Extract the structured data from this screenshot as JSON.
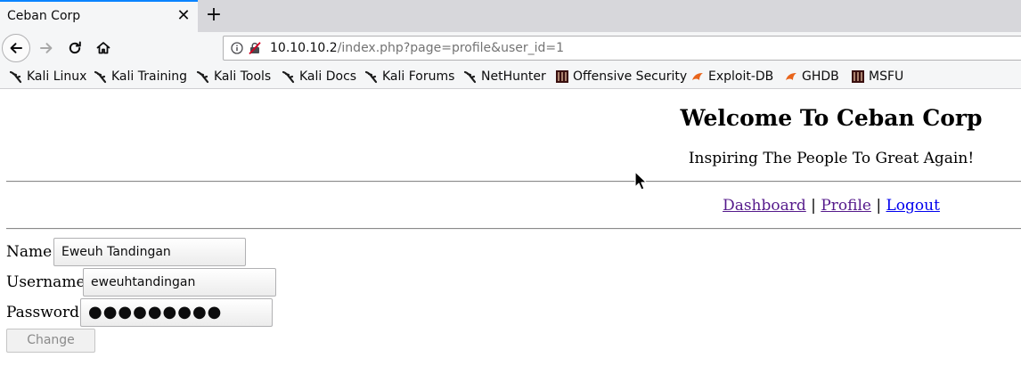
{
  "browser": {
    "tab_title": "Ceban Corp",
    "close_symbol": "✕",
    "new_tab_symbol": "+",
    "url_host": "10.10.10.2",
    "url_path": "/index.php?page=profile&user_id=1",
    "bookmarks": [
      {
        "label": "Kali Linux",
        "icon": "kali-dragon-icon"
      },
      {
        "label": "Kali Training",
        "icon": "kali-dragon-icon"
      },
      {
        "label": "Kali Tools",
        "icon": "kali-dragon-icon"
      },
      {
        "label": "Kali Docs",
        "icon": "kali-dragon-icon"
      },
      {
        "label": "Kali Forums",
        "icon": "kali-dragon-icon"
      },
      {
        "label": "NetHunter",
        "icon": "kali-dragon-icon"
      },
      {
        "label": "Offensive Security",
        "icon": "offsec-icon"
      },
      {
        "label": "Exploit-DB",
        "icon": "exploit-db-icon"
      },
      {
        "label": "GHDB",
        "icon": "exploit-db-icon"
      },
      {
        "label": "MSFU",
        "icon": "offsec-icon"
      }
    ]
  },
  "page": {
    "heading": "Welcome To Ceban Corp",
    "tagline": "Inspiring The People To Great Again!",
    "nav": {
      "dashboard": "Dashboard",
      "separator": "|",
      "profile": "Profile",
      "logout": "Logout"
    },
    "form": {
      "name_label": "Name",
      "name_value": "Eweuh Tandingan",
      "username_label": "Username",
      "username_value": "eweuhtandingan",
      "password_label": "Password",
      "password_masked": "●●●●●●●●●",
      "change_label": "Change"
    }
  },
  "colors": {
    "tab_accent": "#0a84ff",
    "visited_link": "#551a8b",
    "unvisited_link": "#0000ee"
  }
}
